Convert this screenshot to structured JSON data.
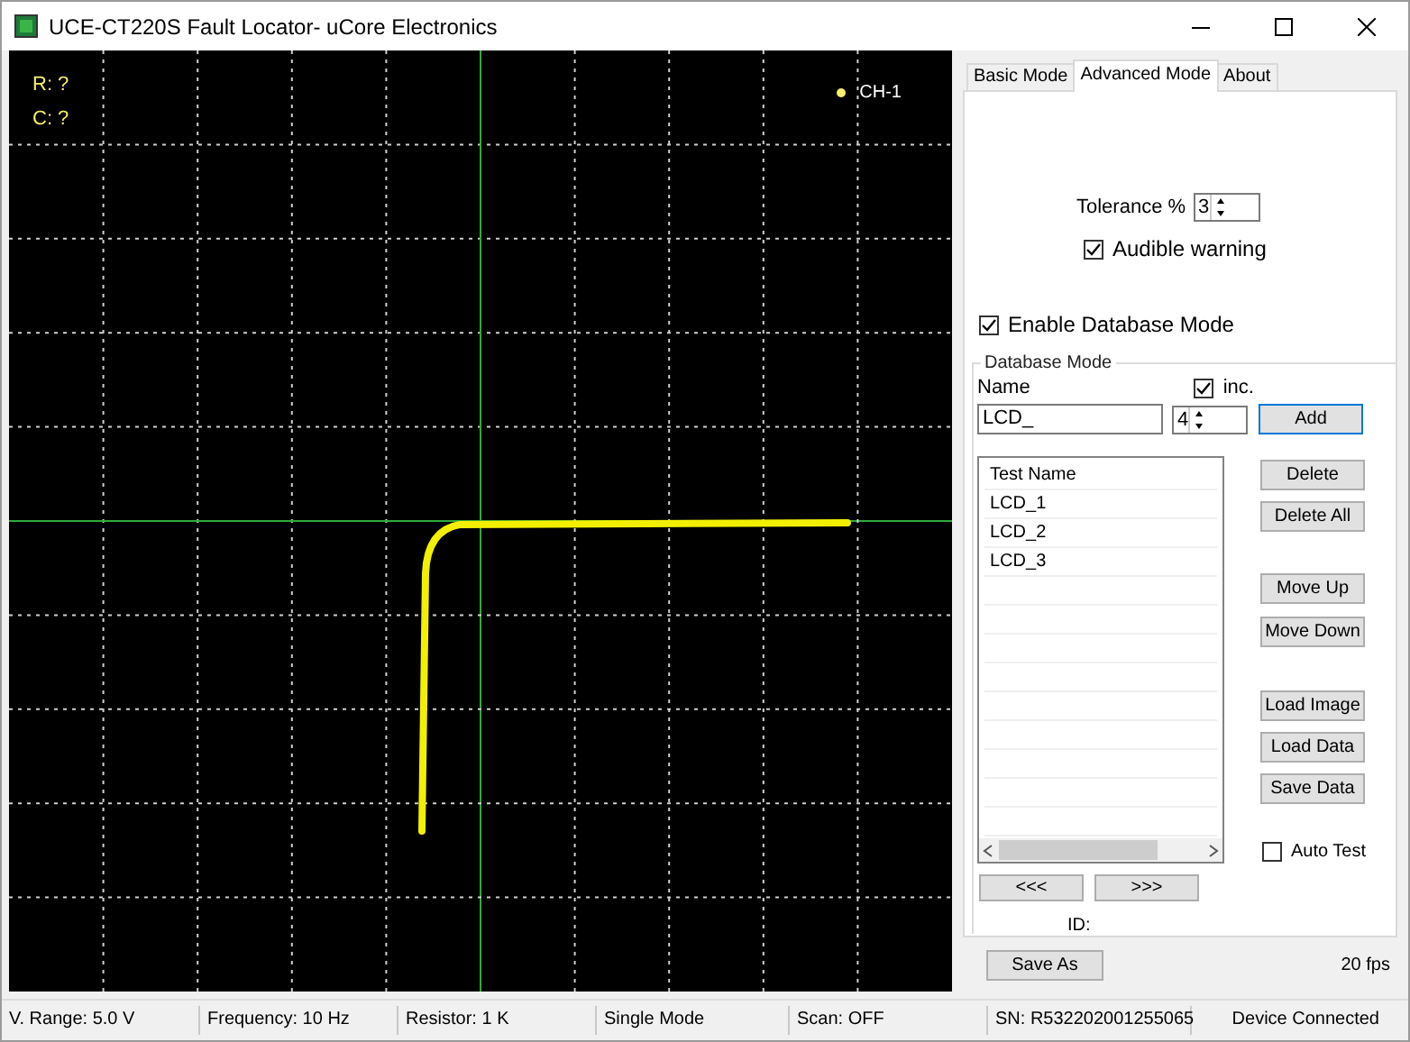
{
  "window": {
    "title": "UCE-CT220S Fault Locator- uCore Electronics"
  },
  "scope": {
    "readouts": [
      "R: ?",
      "C: ?"
    ],
    "channel": {
      "label": "CH-1",
      "color": "#f5ef6a"
    }
  },
  "tabs": [
    {
      "label": "Basic Mode",
      "selected": false
    },
    {
      "label": "Advanced Mode",
      "selected": true
    },
    {
      "label": "About",
      "selected": false
    }
  ],
  "advanced": {
    "tolerance": {
      "label": "Tolerance %",
      "value": "3"
    },
    "audible_warning": {
      "label": "Audible warning",
      "checked": true
    },
    "enable_database": {
      "label": "Enable Database Mode",
      "checked": true
    },
    "database_group": {
      "title": "Database Mode",
      "name_label": "Name",
      "name_value": "LCD_",
      "inc": {
        "label": "inc.",
        "checked": true
      },
      "inc_value": "4",
      "add_button": "Add",
      "list": {
        "header": "Test Name",
        "rows": [
          "LCD_1",
          "LCD_2",
          "LCD_3"
        ]
      },
      "button_groups": [
        [
          "Delete",
          "Delete All"
        ],
        [
          "Move Up",
          "Move Down"
        ],
        [
          "Load Image",
          "Load Data",
          "Save Data"
        ]
      ],
      "auto_test": {
        "label": "Auto Test",
        "checked": false
      },
      "nav_buttons": [
        "<<<",
        ">>>"
      ],
      "id_label": "ID:"
    }
  },
  "save_as": "Save As",
  "fps": "20 fps",
  "status_bar": [
    "V. Range: 5.0 V",
    "Frequency: 10 Hz",
    "Resistor: 1 K",
    "Single Mode",
    "Scan: OFF",
    "SN: R532202001255065",
    "Device Connected"
  ]
}
